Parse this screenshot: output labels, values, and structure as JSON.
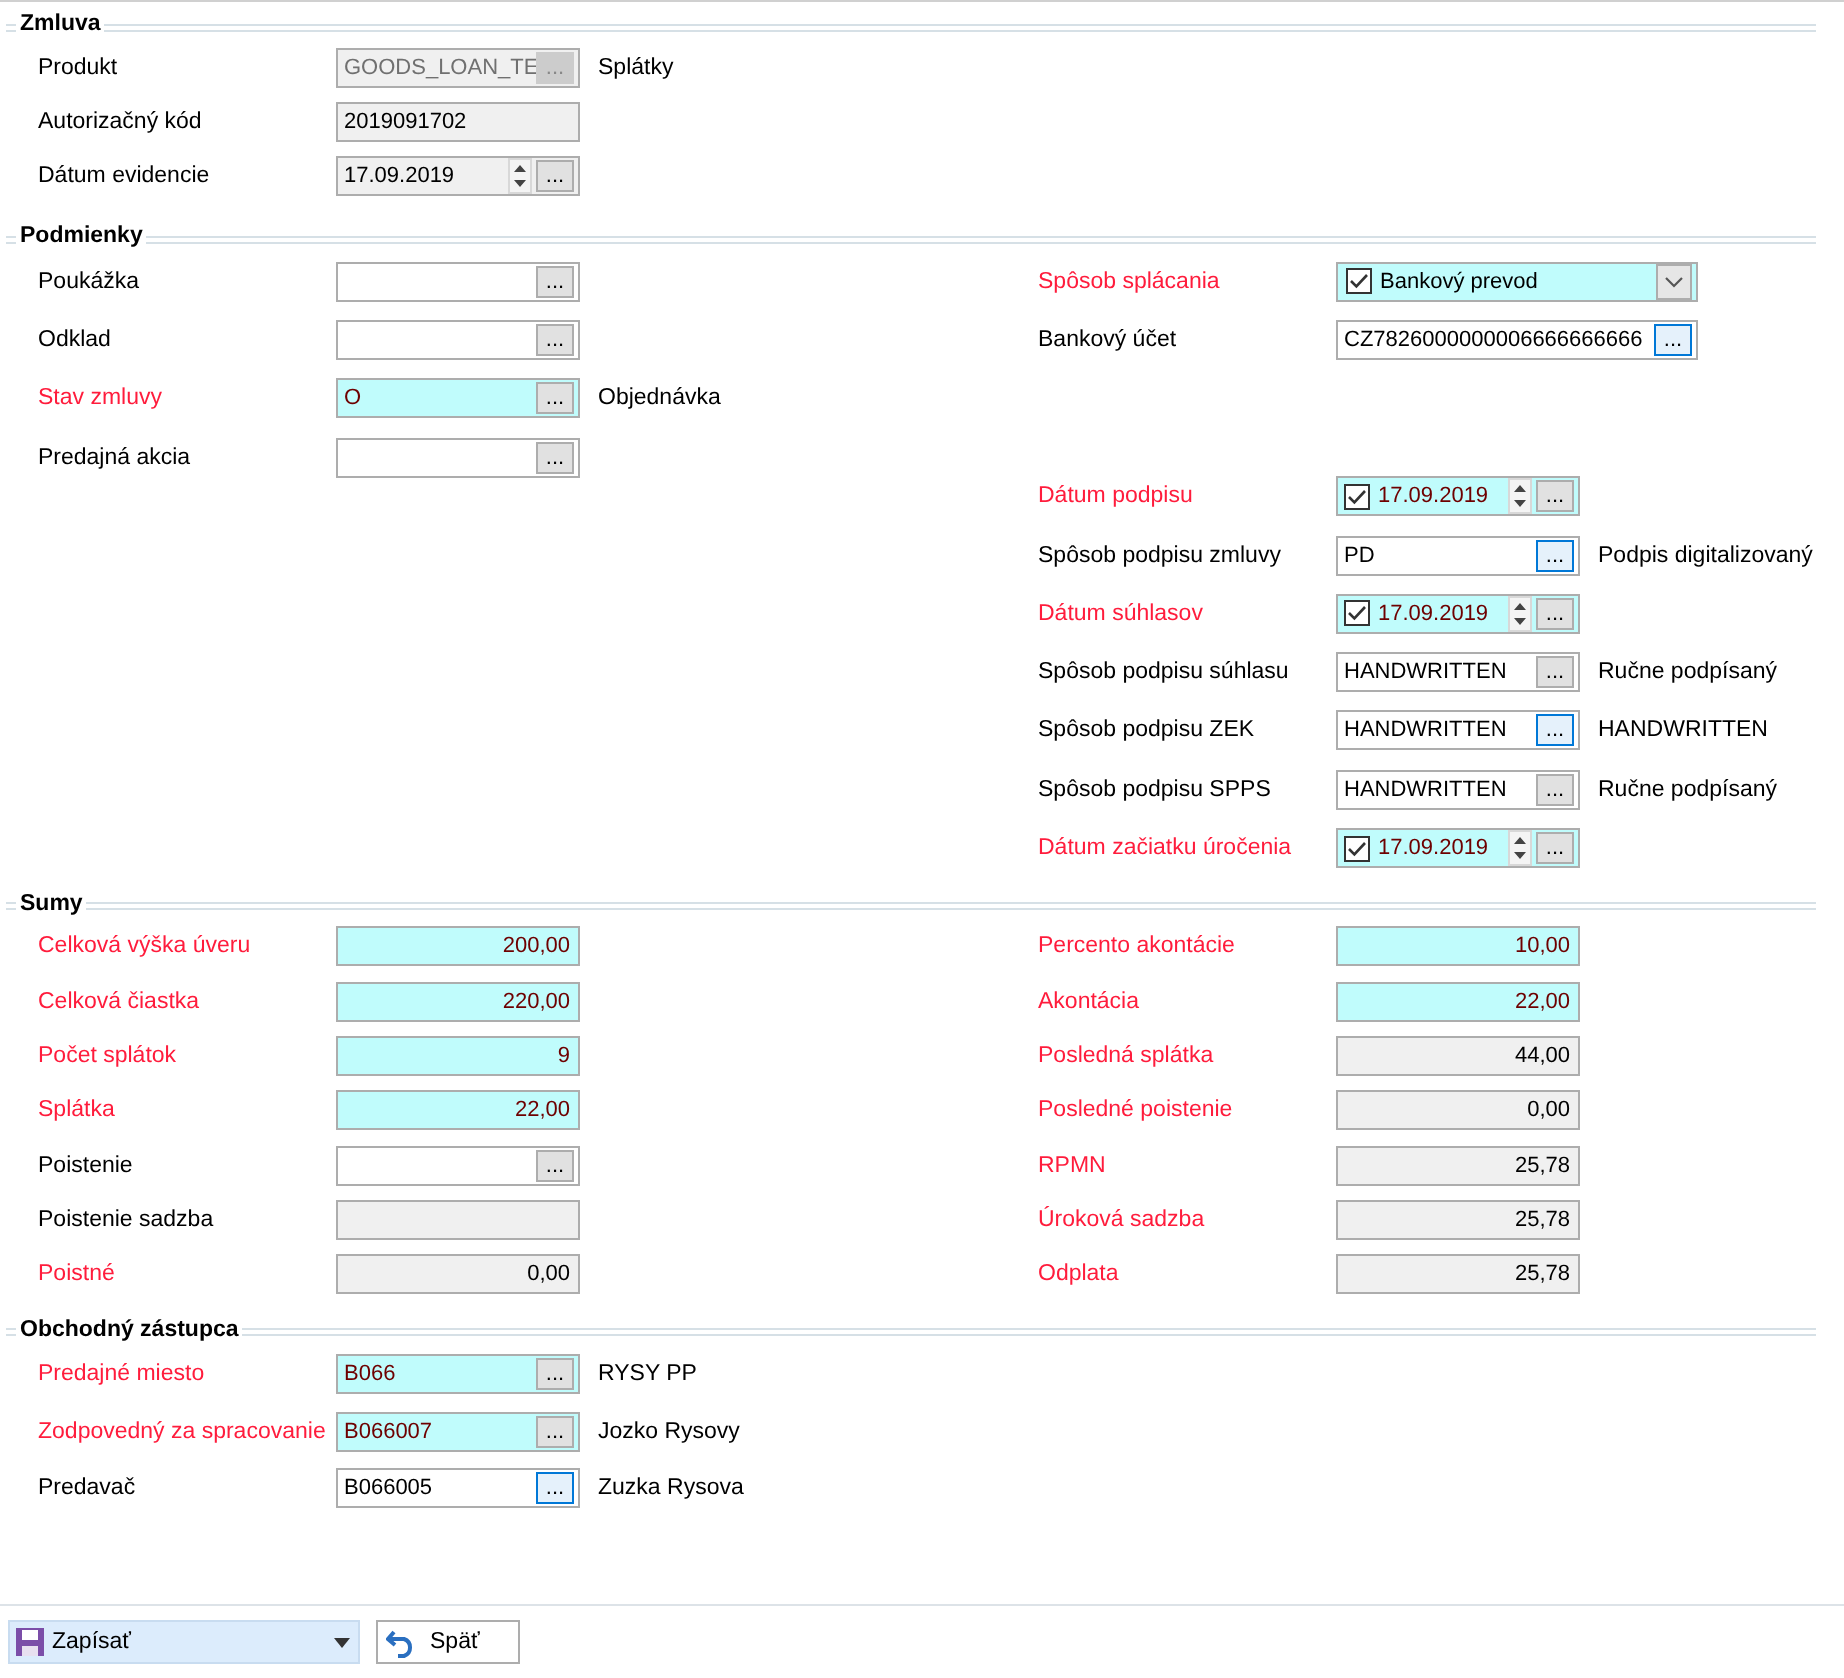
{
  "sections": [
    {
      "title": "Zmluva",
      "columns": [
        {
          "groups": [
            {
              "rows": [
                {
                  "label": "Produkt",
                  "required": false,
                  "field": {
                    "kind": "lookup",
                    "value": "GOODS_LOAN_TE",
                    "highlighted": false,
                    "readonly": true,
                    "disabled": true,
                    "button": {
                      "label": "...",
                      "focused": false
                    }
                  },
                  "note": "Splátky"
                },
                {
                  "label": "Autorizačný kód",
                  "required": false,
                  "field": {
                    "kind": "text",
                    "value": "2019091702",
                    "highlighted": false,
                    "readonly": true
                  }
                },
                {
                  "label": "Dátum evidencie",
                  "required": false,
                  "field": {
                    "kind": "date",
                    "value": "17.09.2019",
                    "highlighted": false,
                    "readonly": true,
                    "button": {
                      "label": "...",
                      "focused": false
                    }
                  }
                }
              ]
            }
          ]
        }
      ]
    },
    {
      "title": "Podmienky",
      "columns": [
        {
          "groups": [
            {
              "rows": [
                {
                  "label": "Poukážka",
                  "required": false,
                  "field": {
                    "kind": "lookup",
                    "highlighted": false,
                    "readonly": false,
                    "button": {
                      "label": "...",
                      "focused": false
                    }
                  }
                },
                {
                  "label": "Odklad",
                  "required": false,
                  "field": {
                    "kind": "lookup",
                    "highlighted": false,
                    "readonly": false,
                    "button": {
                      "label": "...",
                      "focused": false
                    }
                  }
                },
                {
                  "label": "Stav zmluvy",
                  "required": true,
                  "field": {
                    "kind": "lookup",
                    "value": "O",
                    "highlighted": true,
                    "button": {
                      "label": "...",
                      "focused": false
                    }
                  },
                  "note": "Objednávka"
                },
                {
                  "label": "Predajná akcia",
                  "required": false,
                  "field": {
                    "kind": "lookup",
                    "highlighted": false,
                    "readonly": false,
                    "button": {
                      "label": "...",
                      "focused": false
                    }
                  }
                }
              ]
            }
          ]
        },
        {
          "groups": [
            {
              "rows": [
                {
                  "label": "Spôsob splácania",
                  "required": true,
                  "field": {
                    "kind": "combo",
                    "value": "Bankový prevod",
                    "highlighted": true,
                    "checked": true,
                    "wide": true
                  }
                },
                {
                  "label": "Bankový účet",
                  "required": false,
                  "field": {
                    "kind": "lookup",
                    "value": "CZ7826000000006666666666",
                    "highlighted": false,
                    "readonly": false,
                    "wide": true,
                    "button": {
                      "label": "...",
                      "focused": true
                    }
                  }
                }
              ]
            },
            {
              "rows": [
                {
                  "label": "Dátum podpisu",
                  "required": true,
                  "field": {
                    "kind": "date",
                    "value": "17.09.2019",
                    "highlighted": true,
                    "checked": true,
                    "button": {
                      "label": "...",
                      "focused": false
                    }
                  }
                },
                {
                  "label": "Spôsob podpisu zmluvy",
                  "required": false,
                  "field": {
                    "kind": "lookup",
                    "value": "PD",
                    "highlighted": false,
                    "readonly": false,
                    "button": {
                      "label": "...",
                      "focused": true
                    }
                  },
                  "note": "Podpis digitalizovaný"
                },
                {
                  "label": "Dátum súhlasov",
                  "required": true,
                  "field": {
                    "kind": "date",
                    "value": "17.09.2019",
                    "highlighted": true,
                    "checked": true,
                    "button": {
                      "label": "...",
                      "focused": false
                    }
                  }
                },
                {
                  "label": "Spôsob podpisu súhlasu",
                  "required": false,
                  "field": {
                    "kind": "lookup",
                    "value": "HANDWRITTEN",
                    "highlighted": false,
                    "readonly": false,
                    "button": {
                      "label": "...",
                      "focused": false
                    }
                  },
                  "note": "Ručne podpísaný"
                },
                {
                  "label": "Spôsob podpisu ZEK",
                  "required": false,
                  "field": {
                    "kind": "lookup",
                    "value": "HANDWRITTEN",
                    "highlighted": false,
                    "readonly": false,
                    "button": {
                      "label": "...",
                      "focused": true
                    }
                  },
                  "note": "HANDWRITTEN"
                },
                {
                  "label": "Spôsob podpisu SPPS",
                  "required": false,
                  "field": {
                    "kind": "lookup",
                    "value": "HANDWRITTEN",
                    "highlighted": false,
                    "readonly": false,
                    "button": {
                      "label": "...",
                      "focused": false
                    }
                  },
                  "note": "Ručne podpísaný"
                },
                {
                  "label": "Dátum začiatku úročenia",
                  "required": true,
                  "field": {
                    "kind": "date",
                    "value": "17.09.2019",
                    "highlighted": true,
                    "checked": true,
                    "button": {
                      "label": "...",
                      "focused": false
                    }
                  }
                }
              ]
            }
          ]
        }
      ]
    },
    {
      "title": "Sumy",
      "columns": [
        {
          "groups": [
            {
              "rows": [
                {
                  "label": "Celková výška úveru",
                  "required": true,
                  "field": {
                    "kind": "number",
                    "value": "200,00",
                    "highlighted": true
                  }
                },
                {
                  "label": "Celková čiastka",
                  "required": true,
                  "field": {
                    "kind": "number",
                    "value": "220,00",
                    "highlighted": true
                  }
                },
                {
                  "label": "Počet splátok",
                  "required": true,
                  "field": {
                    "kind": "number",
                    "value": "9",
                    "highlighted": true
                  }
                },
                {
                  "label": "Splátka",
                  "required": true,
                  "field": {
                    "kind": "number",
                    "value": "22,00",
                    "highlighted": true
                  }
                },
                {
                  "label": "Poistenie",
                  "required": false,
                  "field": {
                    "kind": "lookup",
                    "highlighted": false,
                    "readonly": false,
                    "button": {
                      "label": "...",
                      "focused": false
                    }
                  }
                },
                {
                  "label": "Poistenie sadzba",
                  "required": false,
                  "field": {
                    "kind": "number",
                    "highlighted": false,
                    "readonly": true
                  }
                },
                {
                  "label": "Poistné",
                  "required": true,
                  "field": {
                    "kind": "number",
                    "value": "0,00",
                    "highlighted": false,
                    "readonly": true
                  }
                }
              ]
            }
          ]
        },
        {
          "groups": [
            {
              "rows": [
                {
                  "label": "Percento akontácie",
                  "required": true,
                  "field": {
                    "kind": "number",
                    "value": "10,00",
                    "highlighted": true
                  }
                },
                {
                  "label": "Akontácia",
                  "required": true,
                  "field": {
                    "kind": "number",
                    "value": "22,00",
                    "highlighted": true
                  }
                },
                {
                  "label": "Posledná splátka",
                  "required": true,
                  "field": {
                    "kind": "number",
                    "value": "44,00",
                    "highlighted": false,
                    "readonly": true
                  }
                },
                {
                  "label": "Posledné poistenie",
                  "required": true,
                  "field": {
                    "kind": "number",
                    "value": "0,00",
                    "highlighted": false,
                    "readonly": true
                  }
                },
                {
                  "label": "RPMN",
                  "required": true,
                  "field": {
                    "kind": "number",
                    "value": "25,78",
                    "highlighted": false,
                    "readonly": true
                  }
                },
                {
                  "label": "Úroková sadzba",
                  "required": true,
                  "field": {
                    "kind": "number",
                    "value": "25,78",
                    "highlighted": false,
                    "readonly": true
                  }
                },
                {
                  "label": "Odplata",
                  "required": true,
                  "field": {
                    "kind": "number",
                    "value": "25,78",
                    "highlighted": false,
                    "readonly": true
                  }
                }
              ]
            }
          ]
        }
      ]
    },
    {
      "title": "Obchodný zástupca",
      "columns": [
        {
          "groups": [
            {
              "rows": [
                {
                  "label": "Predajné miesto",
                  "required": true,
                  "field": {
                    "kind": "lookup",
                    "value": "B066",
                    "highlighted": true,
                    "button": {
                      "label": "...",
                      "focused": false
                    }
                  },
                  "note": "RYSY PP"
                },
                {
                  "label": "Zodpovedný za spracovanie",
                  "required": true,
                  "field": {
                    "kind": "lookup",
                    "value": "B066007",
                    "highlighted": true,
                    "button": {
                      "label": "...",
                      "focused": false
                    }
                  },
                  "note": "Jozko Rysovy"
                },
                {
                  "label": "Predavač",
                  "required": false,
                  "field": {
                    "kind": "lookup",
                    "value": "B066005",
                    "highlighted": false,
                    "readonly": false,
                    "button": {
                      "label": "...",
                      "focused": true
                    }
                  },
                  "note": "Zuzka Rysova"
                }
              ]
            }
          ]
        }
      ]
    }
  ],
  "footer": {
    "save": {
      "label": "Zapísať"
    },
    "back": {
      "label": "Späť"
    }
  }
}
